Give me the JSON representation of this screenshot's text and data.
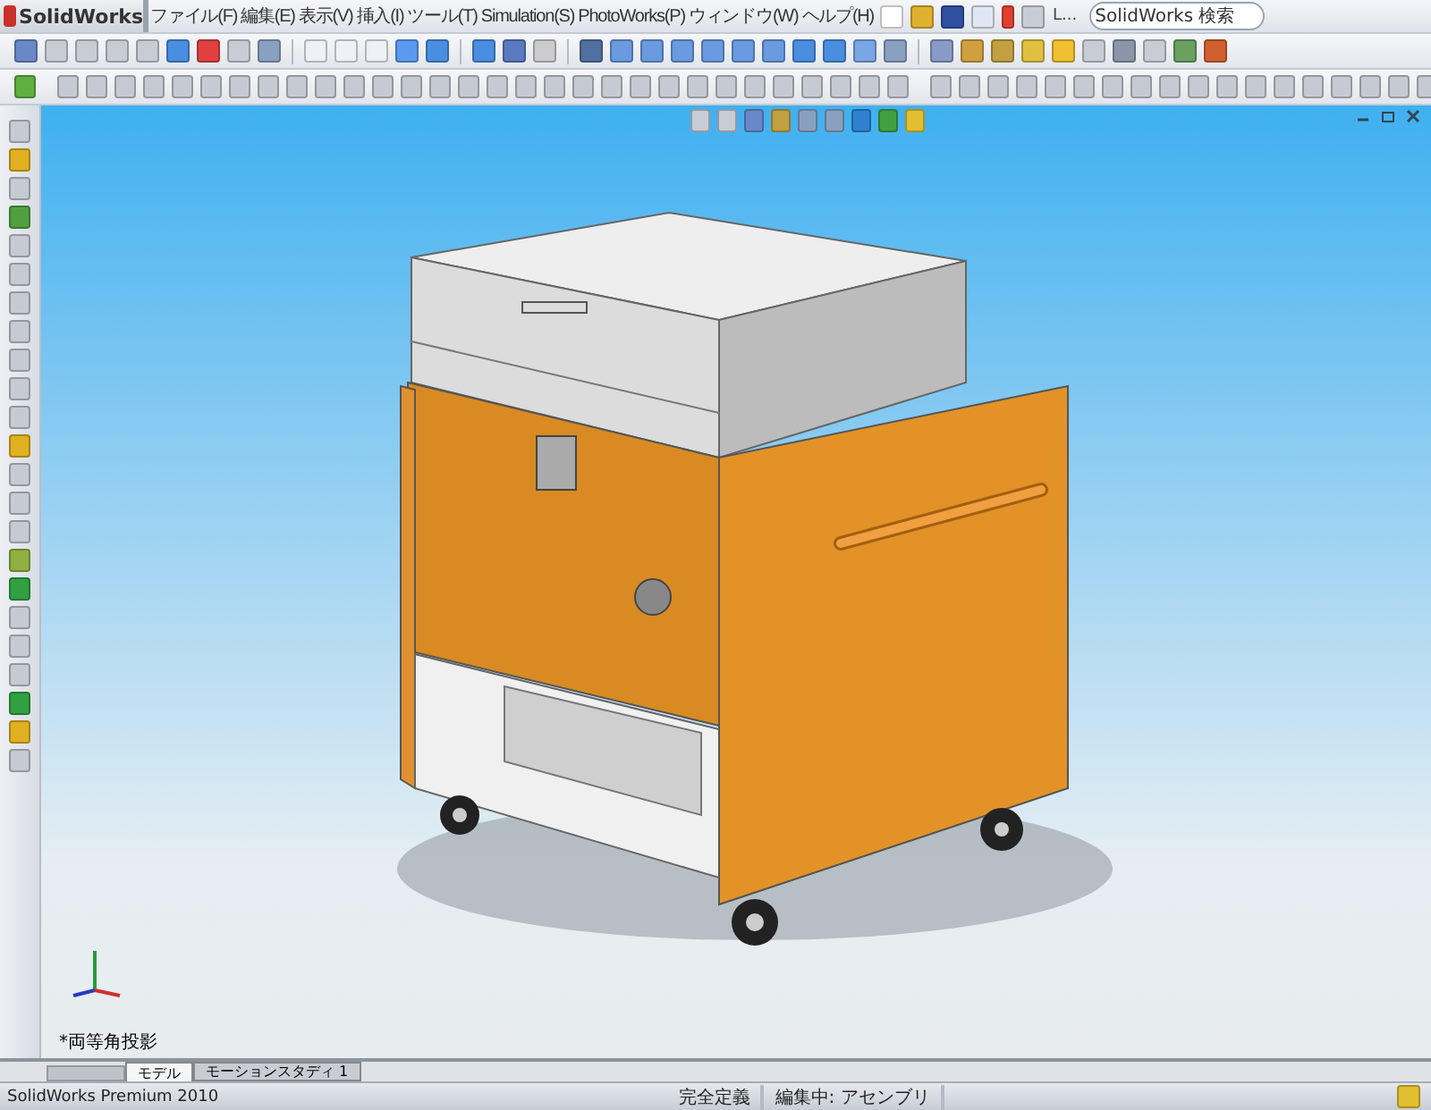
{
  "app": {
    "logo": "SolidWorks"
  },
  "menu": [
    {
      "label": "ファイル(F)"
    },
    {
      "label": "編集(E)"
    },
    {
      "label": "表示(V)"
    },
    {
      "label": "挿入(I)"
    },
    {
      "label": "ツール(T)"
    },
    {
      "label": "Simulation(S)"
    },
    {
      "label": "PhotoWorks(P)"
    },
    {
      "label": "ウィンドウ(W)"
    },
    {
      "label": "ヘルプ(H)"
    }
  ],
  "quick_toolbar": {
    "overflow": "L..."
  },
  "search": {
    "placeholder": "SolidWorks 検索"
  },
  "viewport": {
    "view_label": "*両等角投影"
  },
  "tabs": [
    {
      "label": "モデル",
      "selected": true
    },
    {
      "label": "モーションスタディ 1",
      "selected": false
    }
  ],
  "status_bar": {
    "product": "SolidWorks Premium 2010",
    "fields": [
      "完全定義",
      "編集中: アセンブリ"
    ]
  }
}
